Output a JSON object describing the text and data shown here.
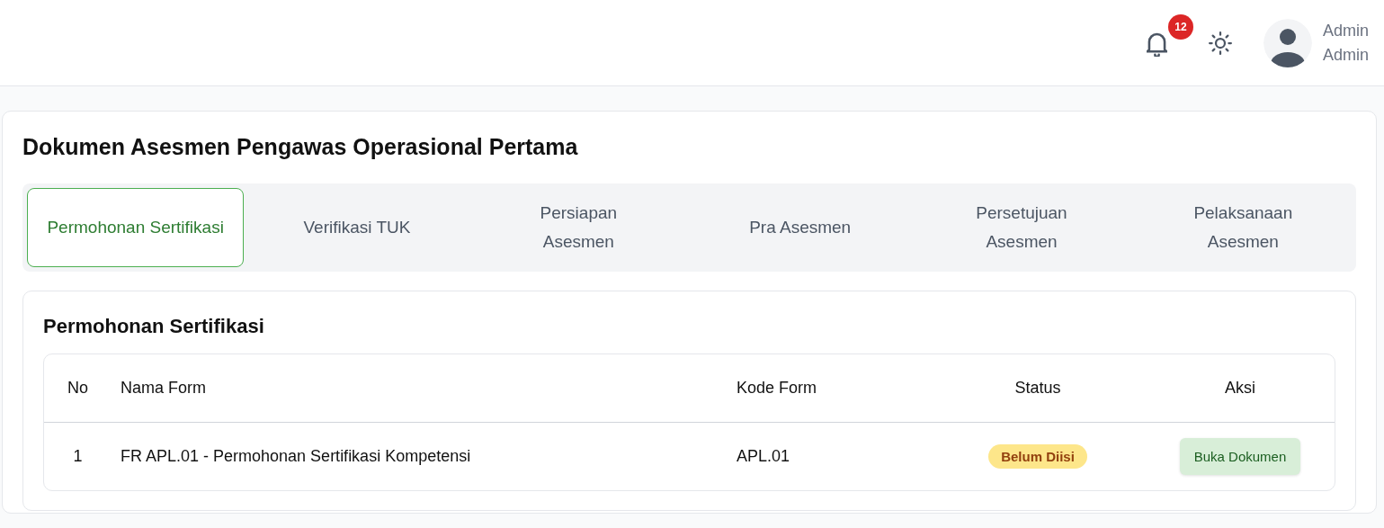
{
  "header": {
    "notification_count": "12",
    "user": {
      "name": "Admin",
      "role": "Admin"
    }
  },
  "title": "Dokumen Asesmen Pengawas Operasional Pertama",
  "tabs": [
    {
      "label": "Permohonan Sertifikasi",
      "selected": true
    },
    {
      "label": "Verifikasi TUK",
      "selected": false
    },
    {
      "label": "Persiapan Asesmen",
      "selected": false
    },
    {
      "label": "Pra Asesmen",
      "selected": false
    },
    {
      "label": "Persetujuan Asesmen",
      "selected": false
    },
    {
      "label": "Pelaksanaan Asesmen",
      "selected": false
    }
  ],
  "section": {
    "title": "Permohonan Sertifikasi",
    "table": {
      "columns": [
        "No",
        "Nama Form",
        "Kode Form",
        "Status",
        "Aksi"
      ],
      "rows": [
        {
          "no": "1",
          "name": "FR APL.01 - Permohonan Sertifikasi Kompetensi",
          "code": "APL.01",
          "status": {
            "label": "Belum Diisi",
            "kind": "pending"
          },
          "action": "Buka Dokumen"
        }
      ]
    }
  }
}
